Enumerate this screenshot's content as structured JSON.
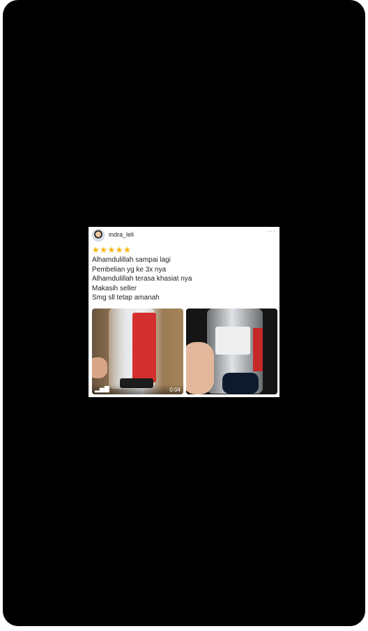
{
  "review": {
    "username": "indra_leli",
    "rating": 5,
    "more_label": "···",
    "lines": [
      "Alhamdulillah sampai lagi",
      "Pembelian yg ke 3x nya",
      "Alhamdulillah terasa khasiat nya",
      "Makasih seller",
      "Smg sll tetap amanah"
    ]
  },
  "media": {
    "video_duration": "0:04",
    "video_icon": "bar-chart-icon"
  },
  "colors": {
    "background": "#000000",
    "star": "#f5b400"
  }
}
